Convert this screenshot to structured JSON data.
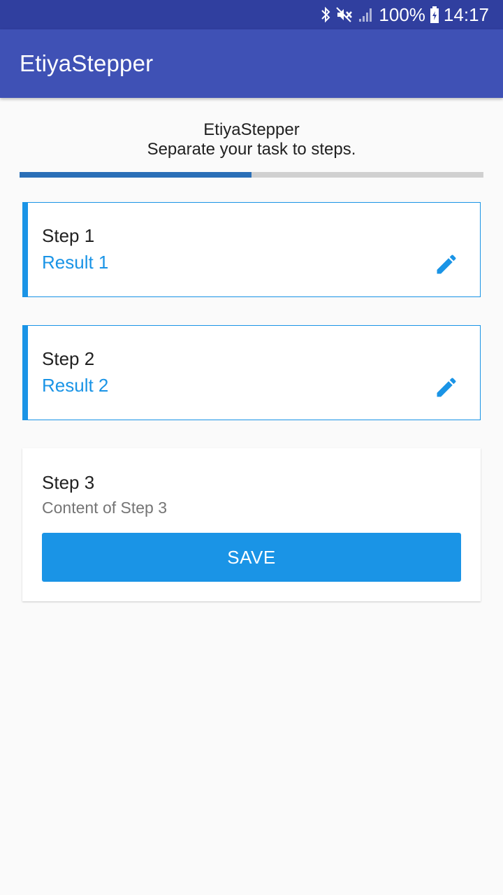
{
  "status_bar": {
    "battery": "100%",
    "time": "14:17",
    "icons": [
      "bluetooth-icon",
      "mute-icon",
      "signal-icon",
      "battery-charging-icon"
    ]
  },
  "app_bar": {
    "title": "EtiyaStepper"
  },
  "header": {
    "title": "EtiyaStepper",
    "subtitle": "Separate your task to steps."
  },
  "progress": {
    "fraction": 0.5,
    "fill_color": "#2a6fb7",
    "track_color": "#d0d0d0"
  },
  "colors": {
    "primary_dark": "#303f9f",
    "primary": "#3f51b5",
    "accent": "#1a94e6"
  },
  "steps": [
    {
      "title": "Step 1",
      "result": "Result 1",
      "icon": "edit-icon"
    },
    {
      "title": "Step 2",
      "result": "Result 2",
      "icon": "edit-icon"
    }
  ],
  "active_step": {
    "title": "Step 3",
    "content": "Content of Step 3",
    "save_label": "SAVE"
  }
}
